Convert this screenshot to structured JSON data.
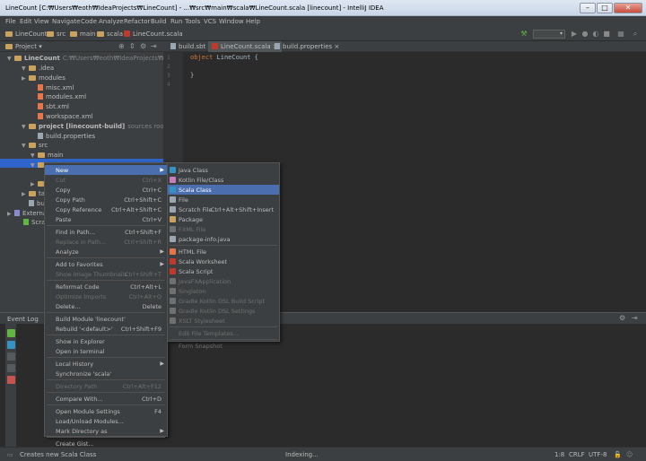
{
  "window": {
    "title": "LineCount [C:₩Users₩eoth₩IdeaProjects₩LineCount] - ...₩src₩main₩scala₩LineCount.scala [linecount] - IntelliJ IDEA",
    "min": "–",
    "max": "□",
    "close": "✕"
  },
  "menubar": [
    "File",
    "Edit",
    "View",
    "Navigate",
    "Code",
    "Analyze",
    "Refactor",
    "Build",
    "Run",
    "Tools",
    "VCS",
    "Window",
    "Help"
  ],
  "breadcrumbs": [
    "LineCount",
    "src",
    "main",
    "scala",
    "LineCount.scala"
  ],
  "toolbar": {
    "run_config": "",
    "dropdown_arrow": "▾"
  },
  "project_panel": {
    "title": "Project",
    "dropdown_arrow": "▾",
    "tree": [
      {
        "label": "LineCount",
        "extra": "C:₩Users₩eoth₩IdeaProjects₩LineCount",
        "icon": "folder-icon",
        "arrow": "▼"
      },
      {
        "label": ".idea",
        "icon": "folder-icon",
        "arrow": "▼"
      },
      {
        "label": "modules",
        "icon": "folder-icon",
        "arrow": "▶"
      },
      {
        "label": "misc.xml",
        "icon": "xml-file-icon",
        "arrow": ""
      },
      {
        "label": "modules.xml",
        "icon": "xml-file-icon",
        "arrow": ""
      },
      {
        "label": "sbt.xml",
        "icon": "xml-file-icon",
        "arrow": ""
      },
      {
        "label": "workspace.xml",
        "icon": "xml-file-icon",
        "arrow": ""
      },
      {
        "label": "project [linecount-build]",
        "extra": "sources root",
        "icon": "folder-icon",
        "arrow": "▼"
      },
      {
        "label": "build.properties",
        "icon": "properties-file-icon",
        "arrow": ""
      },
      {
        "label": "src",
        "icon": "folder-icon",
        "arrow": "▼"
      },
      {
        "label": "main",
        "icon": "folder-icon",
        "arrow": "▼"
      },
      {
        "label": "scala",
        "icon": "folder-icon",
        "arrow": "▼"
      },
      {
        "label": "te",
        "icon": "folder-icon",
        "arrow": "▶"
      },
      {
        "label": "target",
        "icon": "folder-icon",
        "arrow": "▶"
      },
      {
        "label": "build",
        "icon": "file-icon",
        "arrow": ""
      },
      {
        "label": "External",
        "icon": "library-icon",
        "arrow": "▶"
      },
      {
        "label": "Scratche",
        "icon": "scratch-icon",
        "arrow": ""
      }
    ]
  },
  "tabs": [
    {
      "label": "build.sbt",
      "close": "×"
    },
    {
      "label": "LineCount.scala",
      "close": "×"
    },
    {
      "label": "build.properties",
      "close": "×"
    }
  ],
  "editor": {
    "line_numbers": [
      "1",
      "2",
      "3",
      "4"
    ],
    "keyword": "object",
    "line1_rest": " LineCount {",
    "line3": "}"
  },
  "event_log": {
    "title": "Event Log"
  },
  "status": {
    "message": "Creates new Scala Class",
    "indexing": "Indexing...",
    "position": "1:8",
    "line_sep": "CRLF",
    "encoding": "UTF-8"
  },
  "context_menu": [
    {
      "label": "New",
      "shortcut": "",
      "submenu": true,
      "highlighted": true
    },
    {
      "label": "Cut",
      "shortcut": "Ctrl+X",
      "disabled": true
    },
    {
      "label": "Copy",
      "shortcut": "Ctrl+C"
    },
    {
      "label": "Copy Path",
      "shortcut": "Ctrl+Shift+C"
    },
    {
      "label": "Copy Reference",
      "shortcut": "Ctrl+Alt+Shift+C"
    },
    {
      "label": "Paste",
      "shortcut": "Ctrl+V"
    },
    {
      "sep": true
    },
    {
      "label": "Find in Path...",
      "shortcut": "Ctrl+Shift+F"
    },
    {
      "label": "Replace in Path...",
      "shortcut": "Ctrl+Shift+R",
      "disabled": true
    },
    {
      "label": "Analyze",
      "shortcut": "",
      "submenu": true
    },
    {
      "sep": true
    },
    {
      "label": "Add to Favorites",
      "shortcut": "",
      "submenu": true
    },
    {
      "label": "Show Image Thumbnails",
      "shortcut": "Ctrl+Shift+T",
      "disabled": true
    },
    {
      "sep": true
    },
    {
      "label": "Reformat Code",
      "shortcut": "Ctrl+Alt+L"
    },
    {
      "label": "Optimize Imports",
      "shortcut": "Ctrl+Alt+O",
      "disabled": true
    },
    {
      "label": "Delete...",
      "shortcut": "Delete"
    },
    {
      "sep": true
    },
    {
      "label": "Build Module 'linecount'",
      "shortcut": ""
    },
    {
      "label": "Rebuild '<default>'",
      "shortcut": "Ctrl+Shift+F9"
    },
    {
      "sep": true
    },
    {
      "label": "Show in Explorer",
      "shortcut": ""
    },
    {
      "label": "Open in terminal",
      "shortcut": ""
    },
    {
      "sep": true
    },
    {
      "label": "Local History",
      "shortcut": "",
      "submenu": true
    },
    {
      "label": "Synchronize 'scala'",
      "shortcut": ""
    },
    {
      "sep": true
    },
    {
      "label": "Directory Path",
      "shortcut": "Ctrl+Alt+F12",
      "disabled": true
    },
    {
      "sep": true
    },
    {
      "label": "Compare With...",
      "shortcut": "Ctrl+D"
    },
    {
      "sep": true
    },
    {
      "label": "Open Module Settings",
      "shortcut": "F4"
    },
    {
      "label": "Load/Unload Modules...",
      "shortcut": ""
    },
    {
      "label": "Mark Directory as",
      "shortcut": "",
      "submenu": true
    },
    {
      "sep": true
    },
    {
      "label": "Create Gist...",
      "shortcut": ""
    }
  ],
  "new_submenu": [
    {
      "label": "Java Class",
      "shortcut": "",
      "icon_color": "#3592c4"
    },
    {
      "label": "Kotlin File/Class",
      "shortcut": "",
      "icon_color": "#c77dbb"
    },
    {
      "label": "Scala Class",
      "shortcut": "",
      "icon_color": "#3592c4",
      "highlighted": true
    },
    {
      "label": "File",
      "shortcut": "",
      "icon_color": "#9aa7b0"
    },
    {
      "label": "Scratch File",
      "shortcut": "Ctrl+Alt+Shift+Insert",
      "icon_color": "#9aa7b0"
    },
    {
      "label": "Package",
      "shortcut": "",
      "icon_color": "#c9a35d"
    },
    {
      "label": "FXML File",
      "shortcut": "",
      "icon_color": "#707070",
      "disabled": true
    },
    {
      "label": "package-info.java",
      "shortcut": "",
      "icon_color": "#9aa7b0"
    },
    {
      "sep": true
    },
    {
      "label": "HTML File",
      "shortcut": "",
      "icon_color": "#e8754a"
    },
    {
      "label": "Scala Worksheet",
      "shortcut": "",
      "icon_color": "#c0392b"
    },
    {
      "label": "Scala Script",
      "shortcut": "",
      "icon_color": "#c0392b"
    },
    {
      "label": "JavaFXApplication",
      "shortcut": "",
      "icon_color": "#707070",
      "disabled": true
    },
    {
      "label": "Singleton",
      "shortcut": "",
      "icon_color": "#707070",
      "disabled": true
    },
    {
      "label": "Gradle Kotlin DSL Build Script",
      "shortcut": "",
      "icon_color": "#707070",
      "disabled": true
    },
    {
      "label": "Gradle Kotlin DSL Settings",
      "shortcut": "",
      "icon_color": "#707070",
      "disabled": true
    },
    {
      "label": "XSLT Stylesheet",
      "shortcut": "",
      "icon_color": "#707070",
      "disabled": true
    },
    {
      "sep": true
    },
    {
      "label": "Edit File Templates...",
      "shortcut": "",
      "disabled": true
    },
    {
      "sep": true
    },
    {
      "label": "Form Snapshot",
      "shortcut": "",
      "disabled": true
    }
  ]
}
